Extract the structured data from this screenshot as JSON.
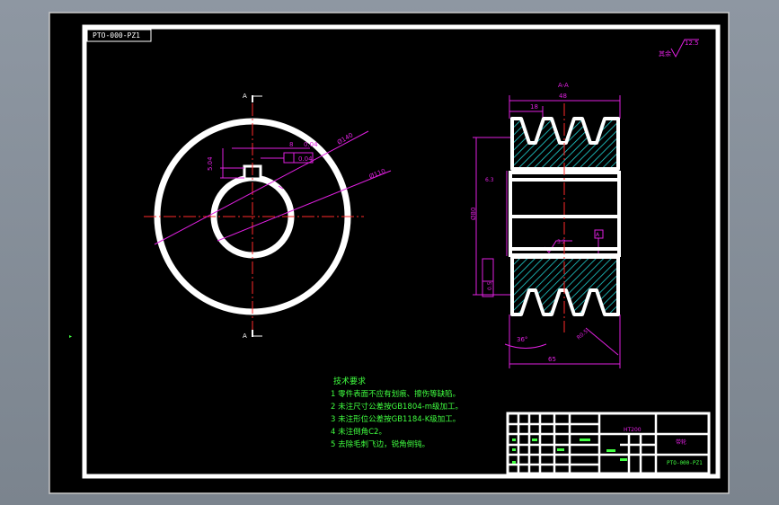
{
  "drawing": {
    "drawing_number": "PTO-000-PZ1",
    "section_label": "A-A",
    "section_mark": "A",
    "roughness_general": "12.5",
    "roughness_other": "其余",
    "dim_face": "48",
    "dim_groove": "18",
    "dim_width": "65",
    "dim_bore": "Ø80",
    "dim_key": "8",
    "dim_key_depth": "5.04",
    "dim_tol_a": "0.04",
    "dim_tol_b": "0.04",
    "dim_outer": "Ø140",
    "dim_inner": "Ø110",
    "dim_angle": "36°",
    "dim_edge": "0.5",
    "dim_rough_bore": "3.2",
    "dim_rough_groove": "6.3",
    "dim_radius": "R0.5",
    "datum": "A"
  },
  "notes": {
    "title": "技术要求",
    "items": [
      "1  零件表面不应有划痕、擦伤等缺陷。",
      "2  未注尺寸公差按GB1804-m级加工。",
      "3  未注形位公差按GB1184-K级加工。",
      "4  未注倒角C2。",
      "5  去除毛刺飞边，锐角倒钝。"
    ]
  },
  "title_block": {
    "material": "HT200",
    "part_name": "带轮",
    "drawing_no": "PTO-000-PZ1"
  },
  "colors": {
    "background": "#000000",
    "frame": "#ffffff",
    "centerline": "#ff2a2a",
    "dimension": "#e020e0",
    "hatch": "#20d0d0",
    "notes": "#40ff40"
  }
}
